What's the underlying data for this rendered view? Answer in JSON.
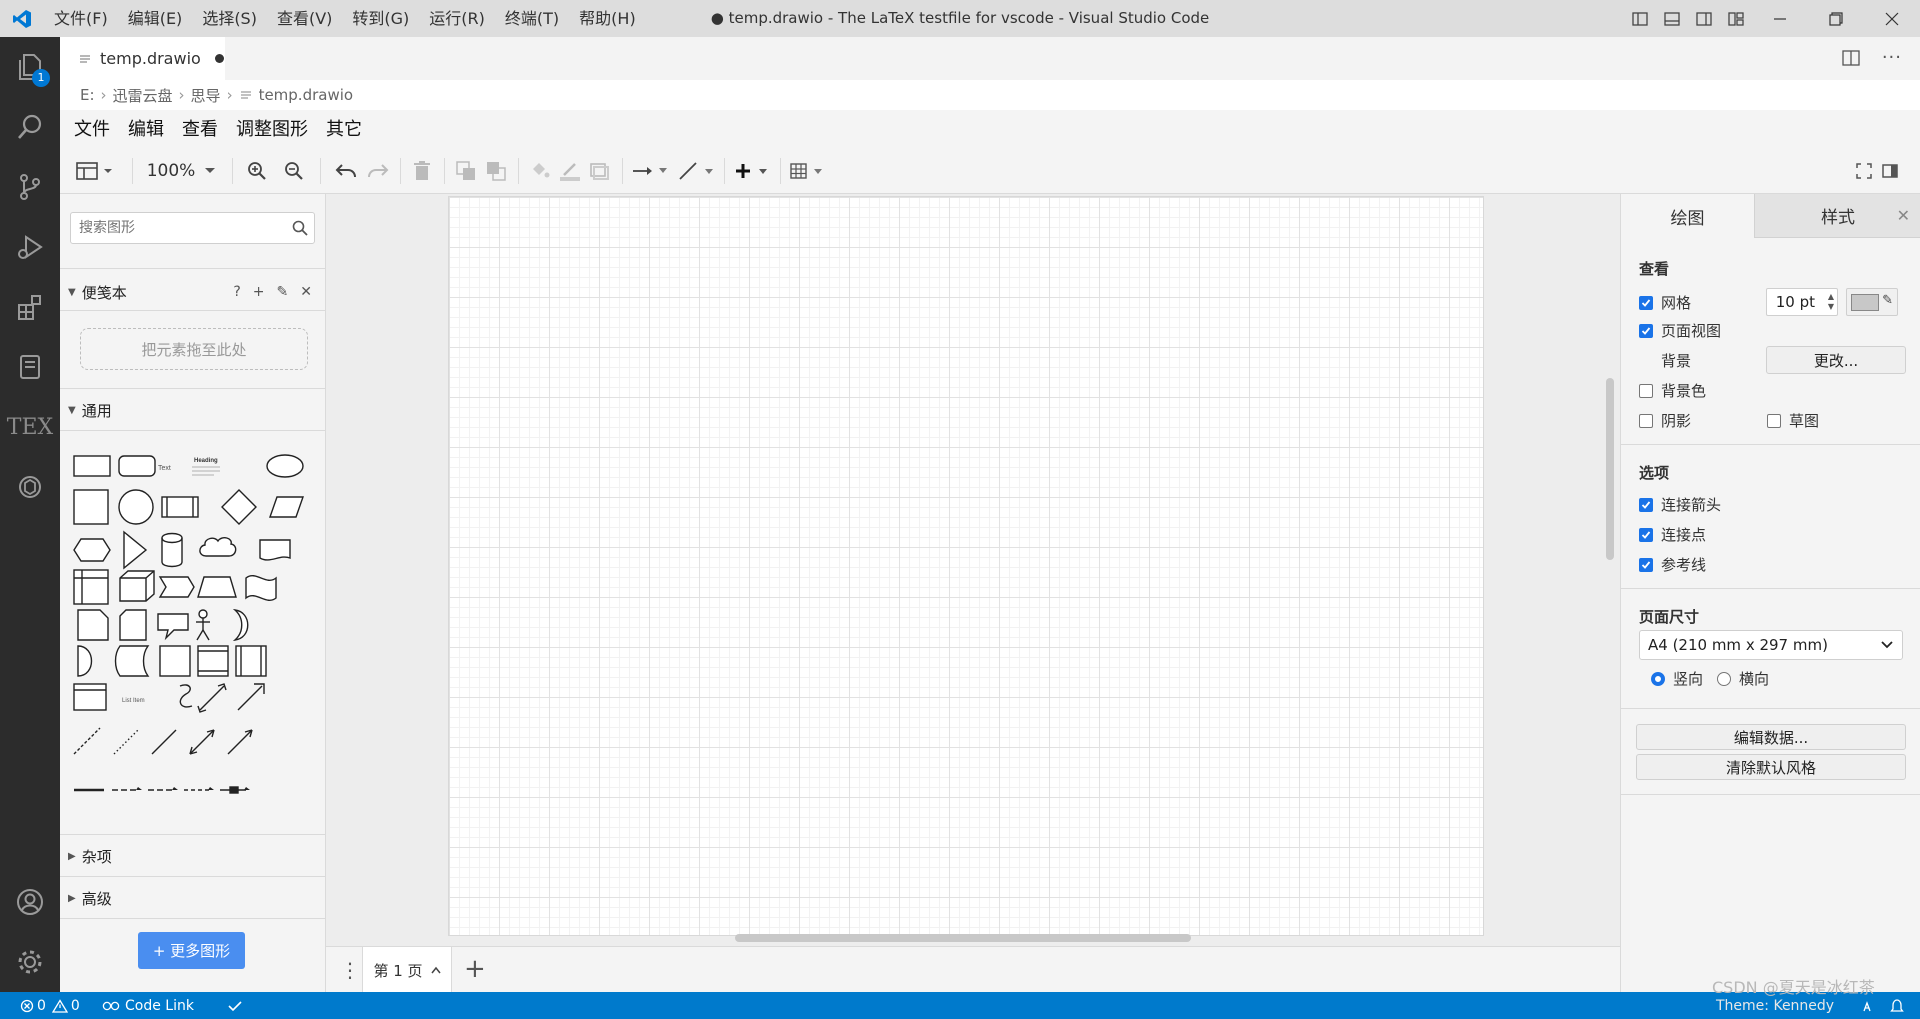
{
  "titlebar": {
    "menu": [
      "文件(F)",
      "编辑(E)",
      "选择(S)",
      "查看(V)",
      "转到(G)",
      "运行(R)",
      "终端(T)",
      "帮助(H)"
    ],
    "window_title": "● temp.drawio - The LaTeX testfile for vscode - Visual Studio Code"
  },
  "activity": {
    "explorer_badge": "1",
    "tex_label": "TEX"
  },
  "tab": {
    "filename": "temp.drawio"
  },
  "breadcrumb": {
    "items": [
      "E:",
      "迅雷云盘",
      "思导",
      "temp.drawio"
    ]
  },
  "drawio_menu": [
    "文件",
    "编辑",
    "查看",
    "调整图形",
    "其它"
  ],
  "toolbar": {
    "zoom": "100%"
  },
  "left": {
    "search_placeholder": "搜索图形",
    "scratchpad_title": "便笺本",
    "scratchpad_help": "?",
    "dropzone": "把元素拖至此处",
    "general_title": "通用",
    "misc_title": "杂项",
    "advanced_title": "高级",
    "more_shapes": "+ 更多图形",
    "shape_text": "Text",
    "shape_heading": "Heading",
    "shape_list_item": "List Item"
  },
  "pages": {
    "current": "第 1 页"
  },
  "right": {
    "tab_diagram": "绘图",
    "tab_style": "样式",
    "view_title": "查看",
    "grid_label": "网格",
    "grid_size": "10 pt",
    "page_view_label": "页面视图",
    "background_label": "背景",
    "change_btn": "更改...",
    "bg_color_label": "背景色",
    "shadow_label": "阴影",
    "sketch_label": "草图",
    "options_title": "选项",
    "connection_arrows": "连接箭头",
    "connection_points": "连接点",
    "guides": "参考线",
    "paper_size_title": "页面尺寸",
    "paper_size": "A4 (210 mm x 297 mm)",
    "portrait": "竖向",
    "landscape": "横向",
    "edit_data_btn": "编辑数据...",
    "clear_style_btn": "清除默认风格",
    "grid_color": "#c8c8c8"
  },
  "statusbar": {
    "errors": "0",
    "warnings": "0",
    "code_link": "Code Link",
    "theme": "Theme: Kennedy",
    "watermark": "CSDN @夏天是冰红茶"
  },
  "colors": {
    "accent": "#007acc",
    "activitybar": "#2c2c2c",
    "more_btn": "#4a8ef0",
    "check": "#1a73e8"
  }
}
